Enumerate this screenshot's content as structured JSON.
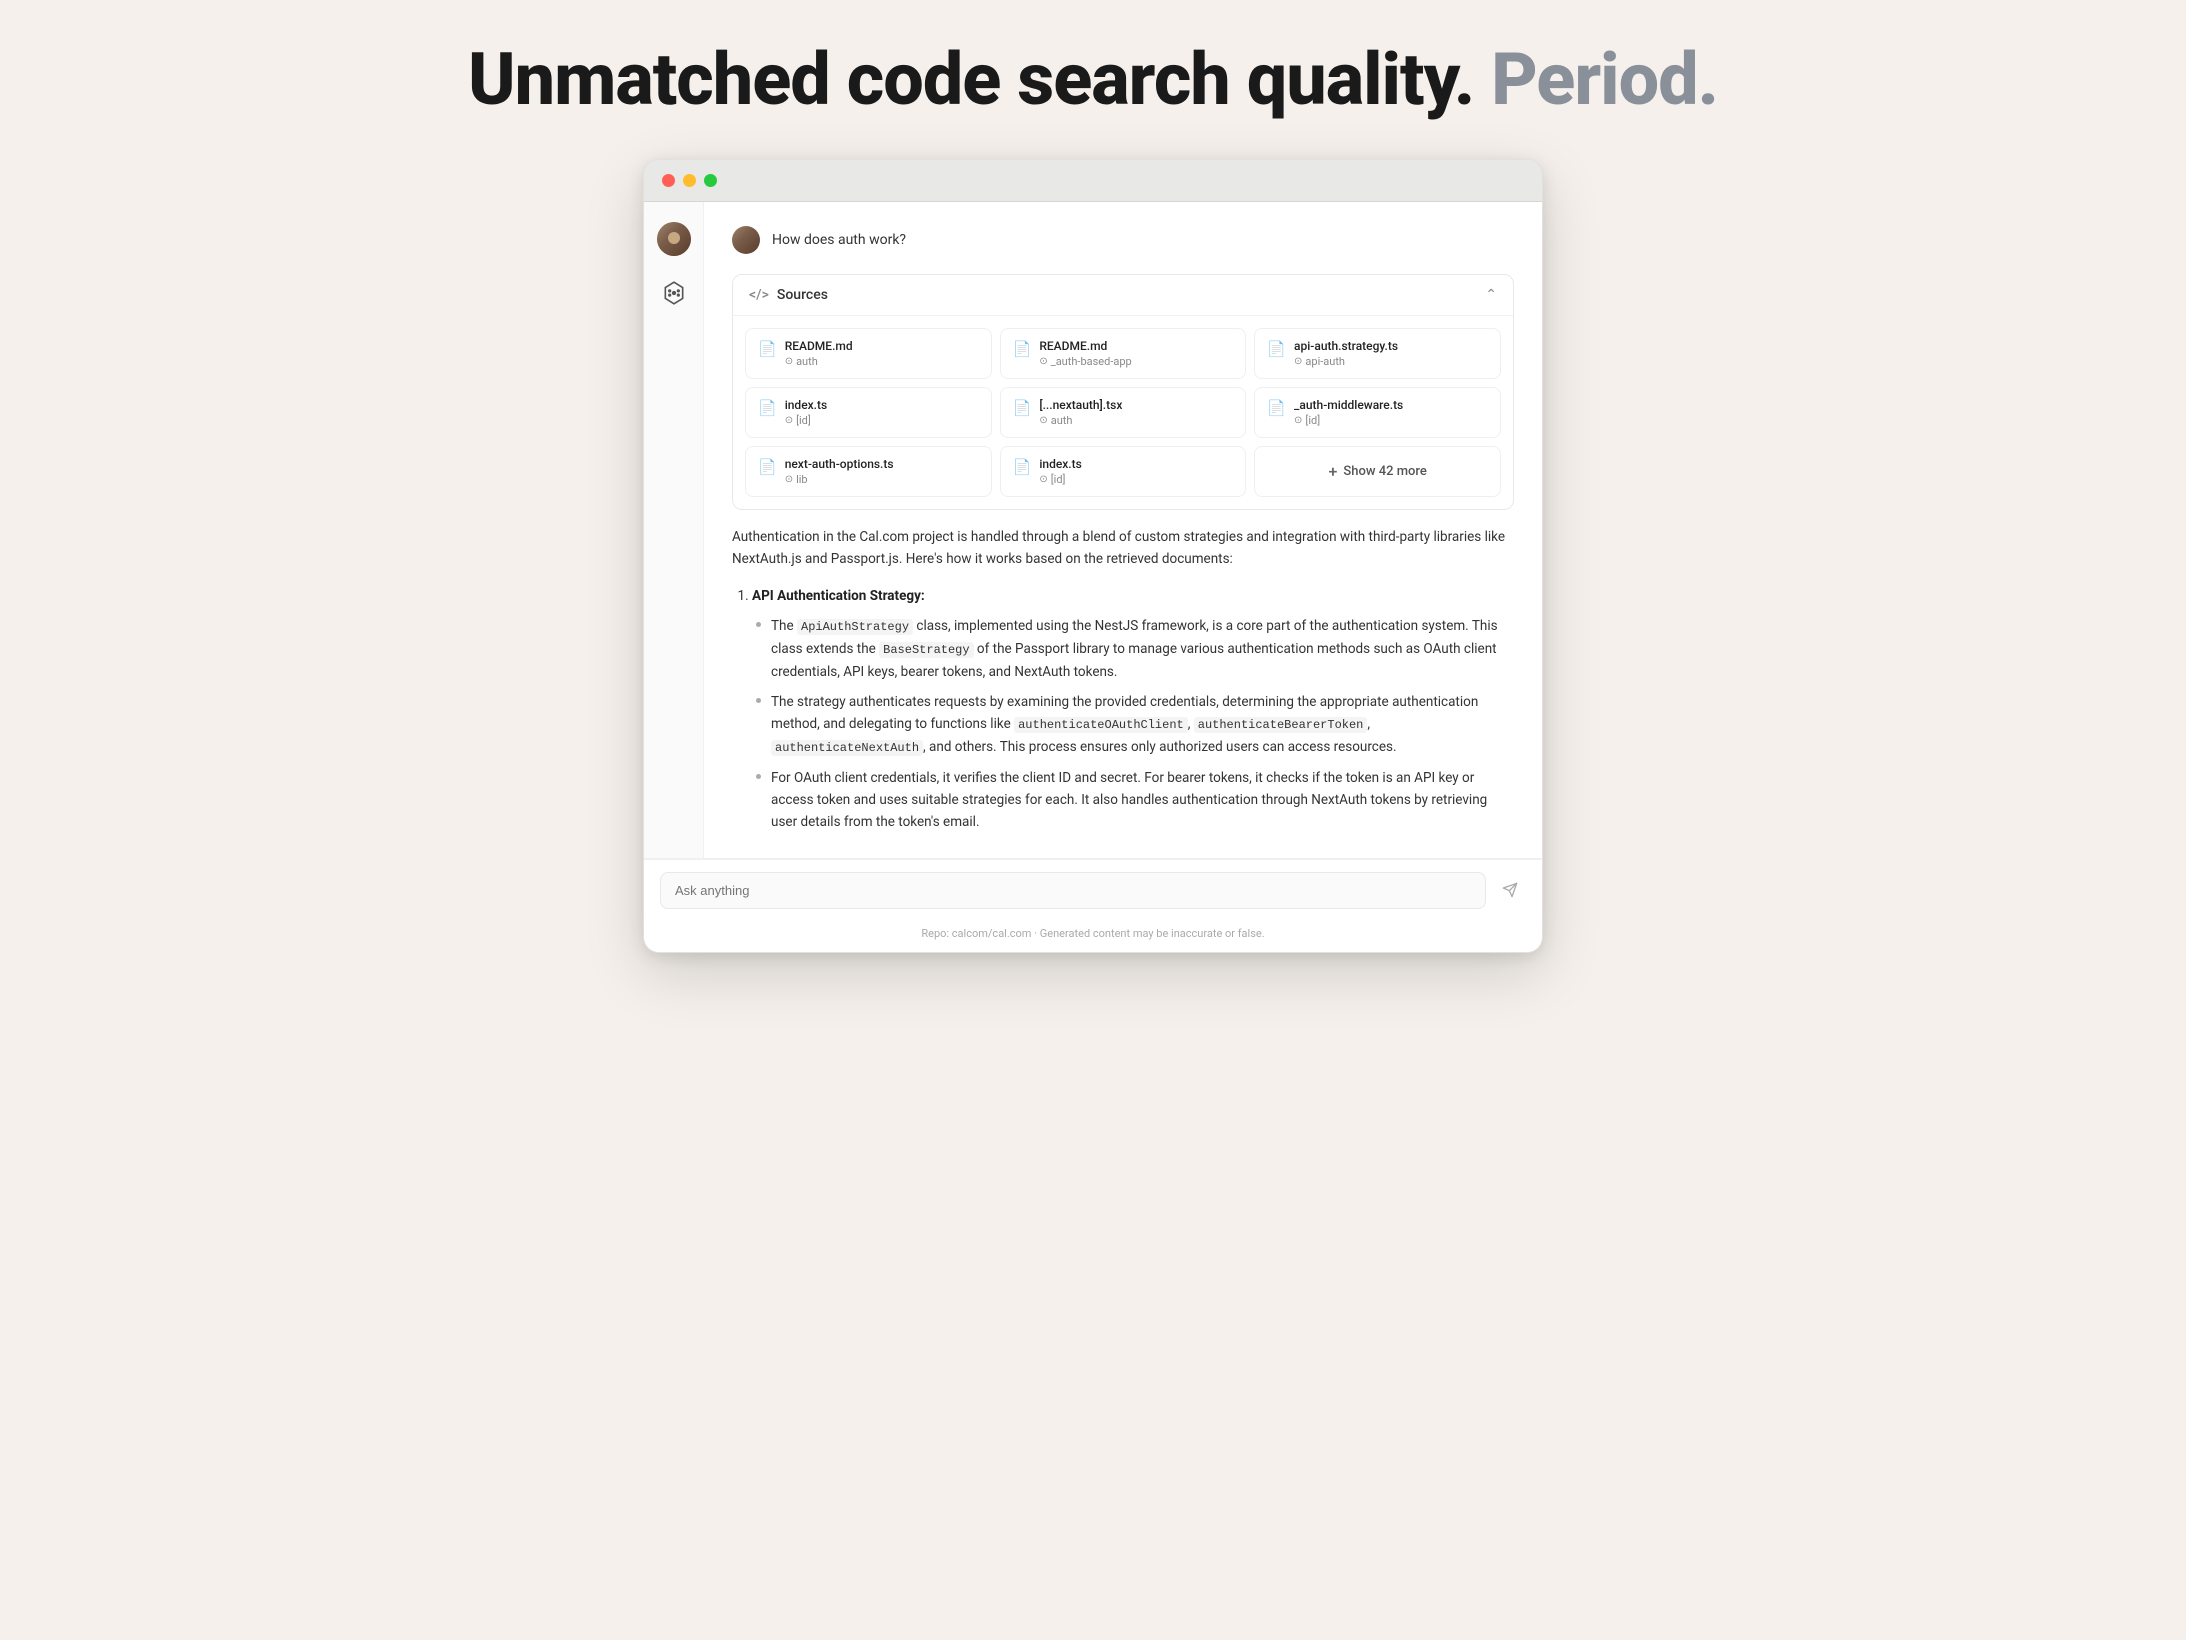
{
  "headline": {
    "part1": "Unmatched code search quality.",
    "part2": "Period."
  },
  "browser": {
    "trafficLights": [
      "red",
      "yellow",
      "green"
    ]
  },
  "query": {
    "text": "How does auth work?"
  },
  "sources": {
    "title": "Sources",
    "codeLabel": "</>",
    "files": [
      {
        "name": "README.md",
        "path": "auth",
        "hasGit": true
      },
      {
        "name": "README.md",
        "path": "_auth-based-app",
        "hasGit": true
      },
      {
        "name": "api-auth.strategy.ts",
        "path": "api-auth",
        "hasGit": true
      },
      {
        "name": "index.ts",
        "path": "[id]",
        "hasGit": true
      },
      {
        "name": "[...nextauth].tsx",
        "path": "auth",
        "hasGit": true
      },
      {
        "name": "_auth-middleware.ts",
        "path": "[id]",
        "hasGit": true
      },
      {
        "name": "next-auth-options.ts",
        "path": "lib",
        "hasGit": true
      },
      {
        "name": "index.ts",
        "path": "[id]",
        "hasGit": true
      }
    ],
    "showMore": {
      "label": "Show 42 more",
      "count": 42
    }
  },
  "answer": {
    "intro": "Authentication in the Cal.com project is handled through a blend of custom strategies and integration with third-party libraries like NextAuth.js and Passport.js. Here's how it works based on the retrieved documents:",
    "sections": [
      {
        "header": "API Authentication Strategy:",
        "bullets": [
          {
            "text": "The ApiAuthStrategy class, implemented using the NestJS framework, is a core part of the authentication system. This class extends the BaseStrategy of the Passport library to manage various authentication methods such as OAuth client credentials, API keys, bearer tokens, and NextAuth tokens.",
            "inlineCodes": [
              "ApiAuthStrategy",
              "BaseStrategy"
            ]
          },
          {
            "text": "The strategy authenticates requests by examining the provided credentials, determining the appropriate authentication method, and delegating to functions like authenticateOAuthClient, authenticateBearerToken, authenticateNextAuth, and others. This process ensures only authorized users can access resources.",
            "inlineCodes": [
              "authenticateOAuthClient",
              "authenticateBearerToken",
              "authenticateNextAuth"
            ]
          },
          {
            "text": "For OAuth client credentials, it verifies the client ID and secret. For bearer tokens, it checks if the token is an API key or access token and uses suitable strategies for each. It also handles authentication through NextAuth tokens by retrieving user details from the token's email.",
            "inlineCodes": []
          }
        ]
      }
    ]
  },
  "input": {
    "placeholder": "Ask anything"
  },
  "footer": {
    "repoLabel": "Repo: calcom/cal.com",
    "disclaimer": "Generated content may be inaccurate or false."
  }
}
